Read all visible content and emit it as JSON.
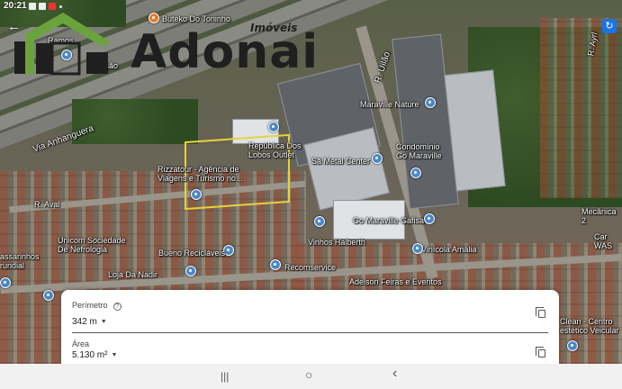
{
  "status_bar": {
    "time": "20:21"
  },
  "logo": {
    "name": "Adonai",
    "tagline": "Imóveis"
  },
  "map": {
    "road_labels": [
      {
        "id": "via-anhanguera",
        "text": "Via Anhanguera"
      },
      {
        "id": "r-uilao",
        "text": "R. Uilão"
      },
      {
        "id": "r-aval",
        "text": "R. Aval"
      },
      {
        "id": "r-right",
        "text": "R. Ayrl"
      }
    ],
    "places": [
      {
        "id": "buteko",
        "text": "Buteko Do Toninho"
      },
      {
        "id": "ramos",
        "text": "Ramos"
      },
      {
        "id": "izacao",
        "text": "ização"
      },
      {
        "id": "maraville-nature",
        "text": "Maraville Nature"
      },
      {
        "id": "republica",
        "text": "República Dos\nLobos Outlet"
      },
      {
        "id": "sametal",
        "text": "Sã Metal Center"
      },
      {
        "id": "condominio",
        "text": "Condomínio\nGo Maraville"
      },
      {
        "id": "rizzatour",
        "text": "Rizzatour - Agência de\nViagens e Turismo no..."
      },
      {
        "id": "gomaraville-gafisa",
        "text": "Go Maraville Gafisa"
      },
      {
        "id": "vinhos",
        "text": "Vinhos Halberth"
      },
      {
        "id": "vinicola",
        "text": "Vinícola Amália"
      },
      {
        "id": "unicom",
        "text": "Unicom Sociedade\nDe Nefrologia"
      },
      {
        "id": "bueno",
        "text": "Bueno Recicláveis"
      },
      {
        "id": "recomservice",
        "text": "Recomservice"
      },
      {
        "id": "assaninhos",
        "text": "assarinhos\nrundial"
      },
      {
        "id": "lojanadir",
        "text": "Loja Da Nadir"
      },
      {
        "id": "adelson",
        "text": "Adelson Feiras e Eventos"
      },
      {
        "id": "mecanica",
        "text": "Mecânica 2"
      },
      {
        "id": "carwash",
        "text": "Car WAS"
      },
      {
        "id": "clean",
        "text": "Clean - Centro\nestético Veicular"
      }
    ]
  },
  "measure": {
    "perimeter_label": "Perímetro",
    "perimeter_value": "342 m",
    "area_label": "Área",
    "area_value": "5.130 m²"
  },
  "navbar": {
    "recents": "|||",
    "home": "○",
    "back": "‹"
  }
}
